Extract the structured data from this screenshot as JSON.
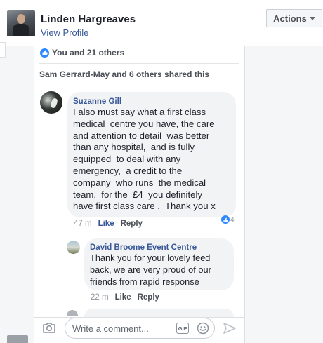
{
  "header": {
    "name": "Linden Hargreaves",
    "view_profile": "View Profile",
    "actions_label": "Actions"
  },
  "post": {
    "reactions_text": "You and 21 others",
    "shared_text": "Sam Gerrard-May and 6 others shared this"
  },
  "comments": [
    {
      "author": "Suzanne Gill",
      "text": "I also must say what a first class\nmedical  centre you have, the care\nand attention to detail  was better\nthan any hospital,  and is fully\nequipped  to deal with any\nemergency,  a credit to the\ncompany  who runs  the medical\nteam,  for the  £4  you definitely\nhave first class care .  Thank you x",
      "time": "47 m",
      "like_label": "Like",
      "reply_label": "Reply",
      "reaction_count": "4"
    },
    {
      "author": "David Broome Event Centre",
      "text": "Thank you for your lovely feed\nback, we are very proud of our\nfriends from rapid response",
      "time": "22 m",
      "like_label": "Like",
      "reply_label": "Reply"
    }
  ],
  "composer": {
    "placeholder": "Write a comment...",
    "gif_label": "GIF"
  },
  "icons": {
    "reaction": "like-icon",
    "camera": "camera-icon",
    "gif": "gif-icon",
    "emoji": "smiley-icon",
    "send": "send-icon",
    "actions": "chevron-down-icon"
  },
  "colors": {
    "link": "#385898",
    "like_blue": "#2d88ff",
    "bubble": "#f2f3f5"
  }
}
